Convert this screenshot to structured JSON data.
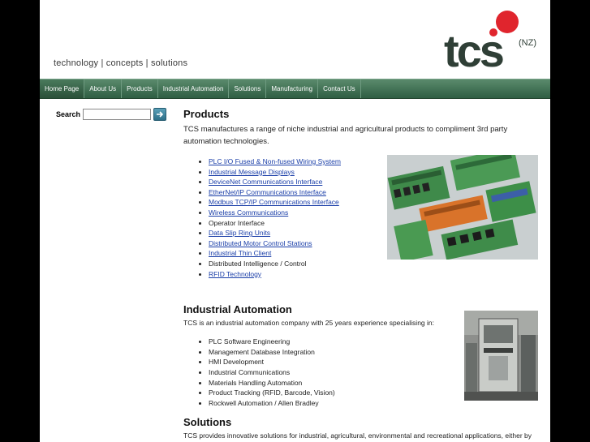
{
  "header": {
    "tagline": "technology | concepts | solutions",
    "logo_text": "tcs",
    "logo_suffix": "(NZ)"
  },
  "nav": [
    {
      "label": "Home Page",
      "active": true
    },
    {
      "label": "About Us"
    },
    {
      "label": "Products"
    },
    {
      "label": "Industrial Automation"
    },
    {
      "label": "Solutions"
    },
    {
      "label": "Manufacturing"
    },
    {
      "label": "Contact Us"
    }
  ],
  "search": {
    "label": "Search",
    "value": "",
    "button_icon": "arrow-right-icon"
  },
  "products": {
    "title": "Products",
    "intro": "TCS manufactures a range of niche industrial and agricultural products to compliment 3rd party automation technologies.",
    "items": [
      {
        "label": "PLC I/O Fused & Non-fused Wiring System",
        "link": true
      },
      {
        "label": "Industrial Message Displays",
        "link": true
      },
      {
        "label": "DeviceNet Communications Interface",
        "link": true
      },
      {
        "label": "EtherNet/IP Communications Interface",
        "link": true
      },
      {
        "label": "Modbus TCP/IP Communications Interface",
        "link": true
      },
      {
        "label": "Wireless Communications",
        "link": true
      },
      {
        "label": "Operator Interface",
        "link": false
      },
      {
        "label": "Data Slip Ring Units",
        "link": true
      },
      {
        "label": "Distributed Motor Control Stations",
        "link": true
      },
      {
        "label": "Industrial Thin Client",
        "link": true
      },
      {
        "label": "Distributed Intelligence / Control",
        "link": false
      },
      {
        "label": "RFID Technology",
        "link": true
      }
    ]
  },
  "automation": {
    "title": "Industrial Automation",
    "intro": "TCS is an industrial automation company with 25 years experience specialising in:",
    "items": [
      "PLC Software Engineering",
      "Management Database Integration",
      "HMI Development",
      "Industrial Communications",
      "Materials Handling Automation",
      "Product Tracking (RFID, Barcode, Vision)",
      "Rockwell Automation / Allen Bradley"
    ]
  },
  "solutions": {
    "title": "Solutions",
    "intro": "TCS provides innovative solutions for industrial, agricultural, environmental and recreational applications, either by partnering with equipment manufacturers or in house development"
  },
  "colors": {
    "nav": "#3d6d50",
    "logo_text": "#2f3f36",
    "logo_dot": "#e0252d",
    "link": "#1a3ea8"
  }
}
